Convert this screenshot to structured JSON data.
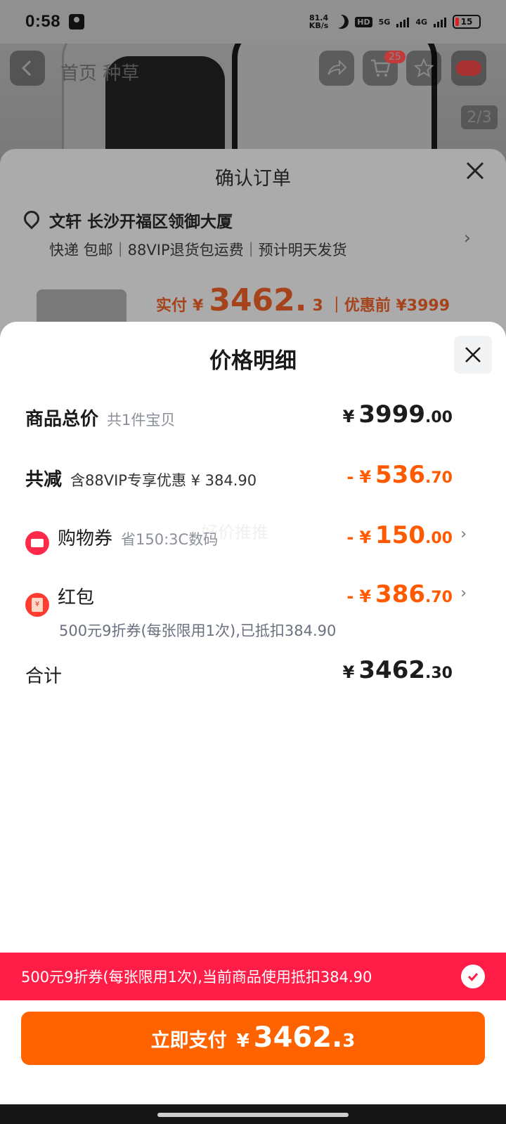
{
  "status_bar": {
    "time": "0:58",
    "net_speed_value": "81.4",
    "net_speed_unit": "KB/s",
    "hd_label": "HD",
    "net_5g": "5G",
    "net_4g": "4G",
    "battery": "15"
  },
  "background_page": {
    "tab_text": "首页 种草",
    "cart_badge": "25",
    "image_counter": "2/3"
  },
  "confirm_order": {
    "title": "确认订单",
    "address": "文轩 长沙开福区领御大厦",
    "shipping": "快递 包邮｜88VIP退货包运费｜预计明天发货",
    "paid_label": "实付",
    "paid_currency": "¥",
    "paid_int": "3462.",
    "paid_dec": "3",
    "original_label": "｜优惠前 ¥3999"
  },
  "price_detail": {
    "title": "价格明细",
    "watermark": "好价推推",
    "rows": {
      "total_goods": {
        "label": "商品总价",
        "sub": "共1件宝贝",
        "currency": "¥",
        "int": "3999",
        "dec": ".00"
      },
      "total_discount": {
        "label": "共减",
        "sub": "含88VIP专享优惠 ¥ 384.90",
        "minus": "-",
        "currency": "¥",
        "int": "536",
        "dec": ".70"
      },
      "shopping_coupon": {
        "label": "购物券",
        "sub": "省150:3C数码",
        "minus": "-",
        "currency": "¥",
        "int": "150",
        "dec": ".00"
      },
      "red_packet": {
        "label": "红包",
        "note": "500元9折券(每张限用1次),已抵扣384.90",
        "minus": "-",
        "currency": "¥",
        "int": "386",
        "dec": ".70"
      },
      "grand_total": {
        "label": "合计",
        "currency": "¥",
        "int": "3462",
        "dec": ".30"
      }
    },
    "notice": "500元9折券(每张限用1次),当前商品使用抵扣384.90",
    "pay_button": {
      "label": "立即支付",
      "currency": "¥",
      "int": "3462.",
      "dec": "3"
    }
  },
  "colors": {
    "accent_orange": "#ff6300",
    "discount_orange": "#ff5a00",
    "notice_red": "#ff1d48"
  },
  "icons": [
    "back-icon",
    "share-icon",
    "cart-icon",
    "star-icon",
    "more-icon",
    "close-icon",
    "location-icon",
    "chevron-right-icon",
    "coupon-icon",
    "red-packet-icon",
    "check-icon"
  ]
}
